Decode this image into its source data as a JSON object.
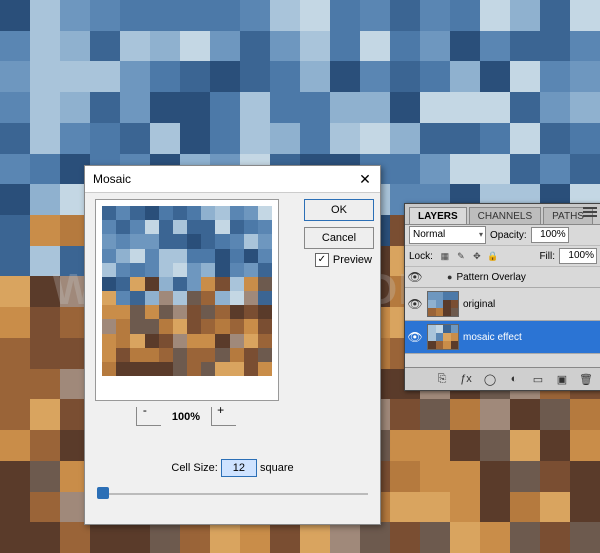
{
  "watermark": "WWW.PSD-DUDE.COM",
  "dialog": {
    "title": "Mosaic",
    "ok": "OK",
    "cancel": "Cancel",
    "preview_label": "Preview",
    "preview_checked": "✓",
    "zoom_pct": "100%",
    "cell_size_label": "Cell Size:",
    "cell_size_value": "12",
    "cell_size_unit": "square"
  },
  "panel": {
    "tabs": [
      "LAYERS",
      "CHANNELS",
      "PATHS"
    ],
    "blend_mode": "Normal",
    "opacity_label": "Opacity:",
    "opacity_value": "100%",
    "lock_label": "Lock:",
    "fill_label": "Fill:",
    "fill_value": "100%",
    "fx_label": "Pattern Overlay",
    "layers": [
      {
        "name": "original"
      },
      {
        "name": "mosaic effect"
      }
    ]
  },
  "colors": {
    "accent": "#2b6fb6",
    "selection": "#2b74d4"
  }
}
